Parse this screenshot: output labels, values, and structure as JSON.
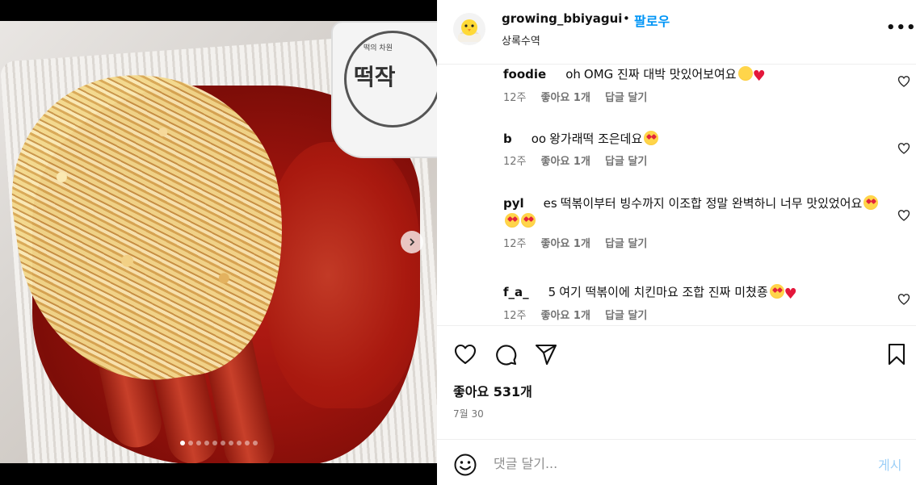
{
  "post": {
    "username": "growing_bbiyagui",
    "separator": "•",
    "follow_label": "팔로우",
    "location": "상록수역",
    "more_label": "•••"
  },
  "media": {
    "pack_brand": "떡작",
    "pack_tagline": "떡의 차원",
    "carousel_count": 10,
    "carousel_active": 0
  },
  "comments": [
    {
      "author": "foodie",
      "author_suffix": "oh",
      "text": "OMG 진짜 대박 맛있어보여요",
      "emojis": [
        "yum",
        "heart"
      ],
      "time": "12주",
      "likes": "좋아요 1개",
      "reply": "답글 달기"
    },
    {
      "author": "b",
      "author_suffix": "oo",
      "text": "왕가래떡 조은데요",
      "emojis": [
        "love"
      ],
      "time": "12주",
      "likes": "좋아요 1개",
      "reply": "답글 달기"
    },
    {
      "author": "pyl",
      "author_suffix": "es",
      "text": "떡볶이부터 빙수까지 이조합 정말 완벽하니 너무 맛있었어요",
      "emojis": [
        "love",
        "love",
        "love"
      ],
      "time": "12주",
      "likes": "좋아요 1개",
      "reply": "답글 달기"
    },
    {
      "author": "f_a_",
      "author_suffix": "5",
      "text": "여기 떡볶이에 치킨마요 조합 진짜 미쳤죵",
      "emojis": [
        "love",
        "heart"
      ],
      "time": "12주",
      "likes": "좋아요 1개",
      "reply": "답글 달기"
    }
  ],
  "actions": {
    "likes_count": "좋아요 531개",
    "date": "7월 30"
  },
  "composer": {
    "placeholder": "댓글 달기...",
    "post_label": "게시"
  },
  "colors": {
    "accent": "#0095f6",
    "post_disabled": "#9ccff7",
    "heart_red": "#e4173b",
    "muted": "#737373"
  }
}
